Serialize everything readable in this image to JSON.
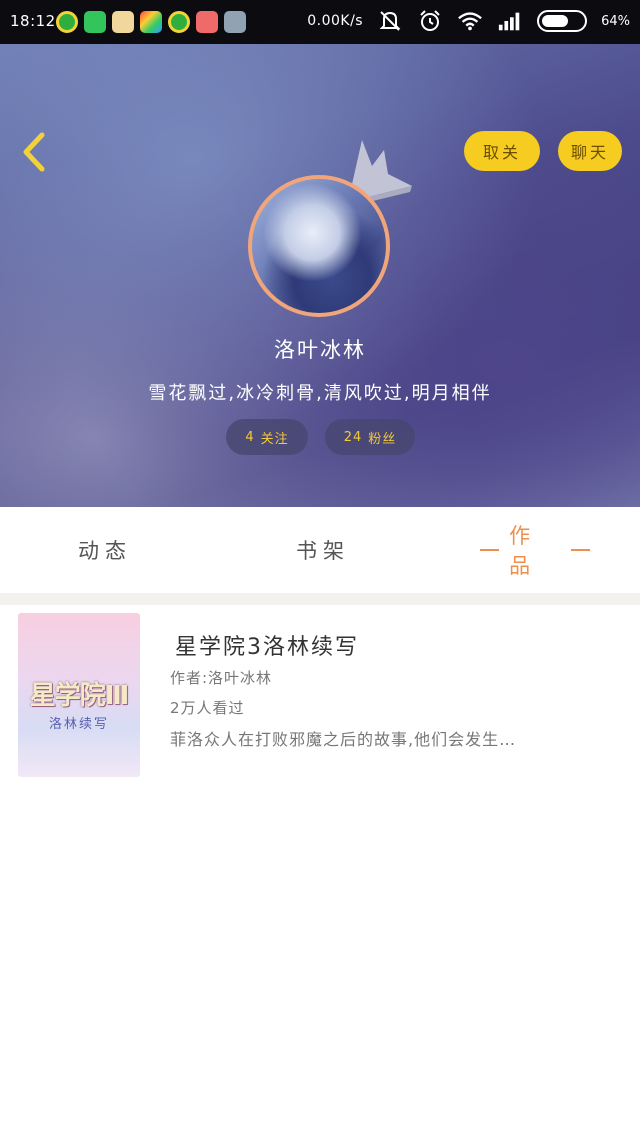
{
  "status_bar": {
    "time": "18:12",
    "net_speed": "0.00K/s",
    "battery": "64%",
    "battery_level": 0.64,
    "app_icons": [
      "green-coin-app-icon",
      "green-plus-app-icon",
      "cartoon-app-icon",
      "game-center-app-icon",
      "green-coin-app-icon",
      "red-shop-app-icon",
      "notes-app-icon"
    ],
    "icons": [
      "mute-vibrate-icon",
      "alarm-icon",
      "wifi-icon",
      "signal-icon"
    ]
  },
  "header": {
    "unfollow_label": "取关",
    "chat_label": "聊天",
    "username": "洛叶冰林",
    "signature": "雪花飘过,冰冷刺骨,清风吹过,明月相伴",
    "follow_count": "4",
    "follow_label": "关注",
    "fans_count": "24",
    "fans_label": "粉丝"
  },
  "tabs": [
    {
      "label": "动态"
    },
    {
      "label": "书架"
    },
    {
      "label": "作品"
    }
  ],
  "works": [
    {
      "cover_title": "星学院Ⅲ",
      "cover_subtitle": "洛林续写",
      "title": "星学院3洛林续写",
      "author": "作者:洛叶冰林",
      "views": "2万人看过",
      "description": "菲洛众人在打败邪魔之后的故事,他们会发生…"
    }
  ],
  "colors": {
    "accent_yellow": "#f5cc1f",
    "tab_active": "#ee8f4d",
    "avatar_border": "#f1a57a",
    "stat_text": "#f3c93a"
  }
}
